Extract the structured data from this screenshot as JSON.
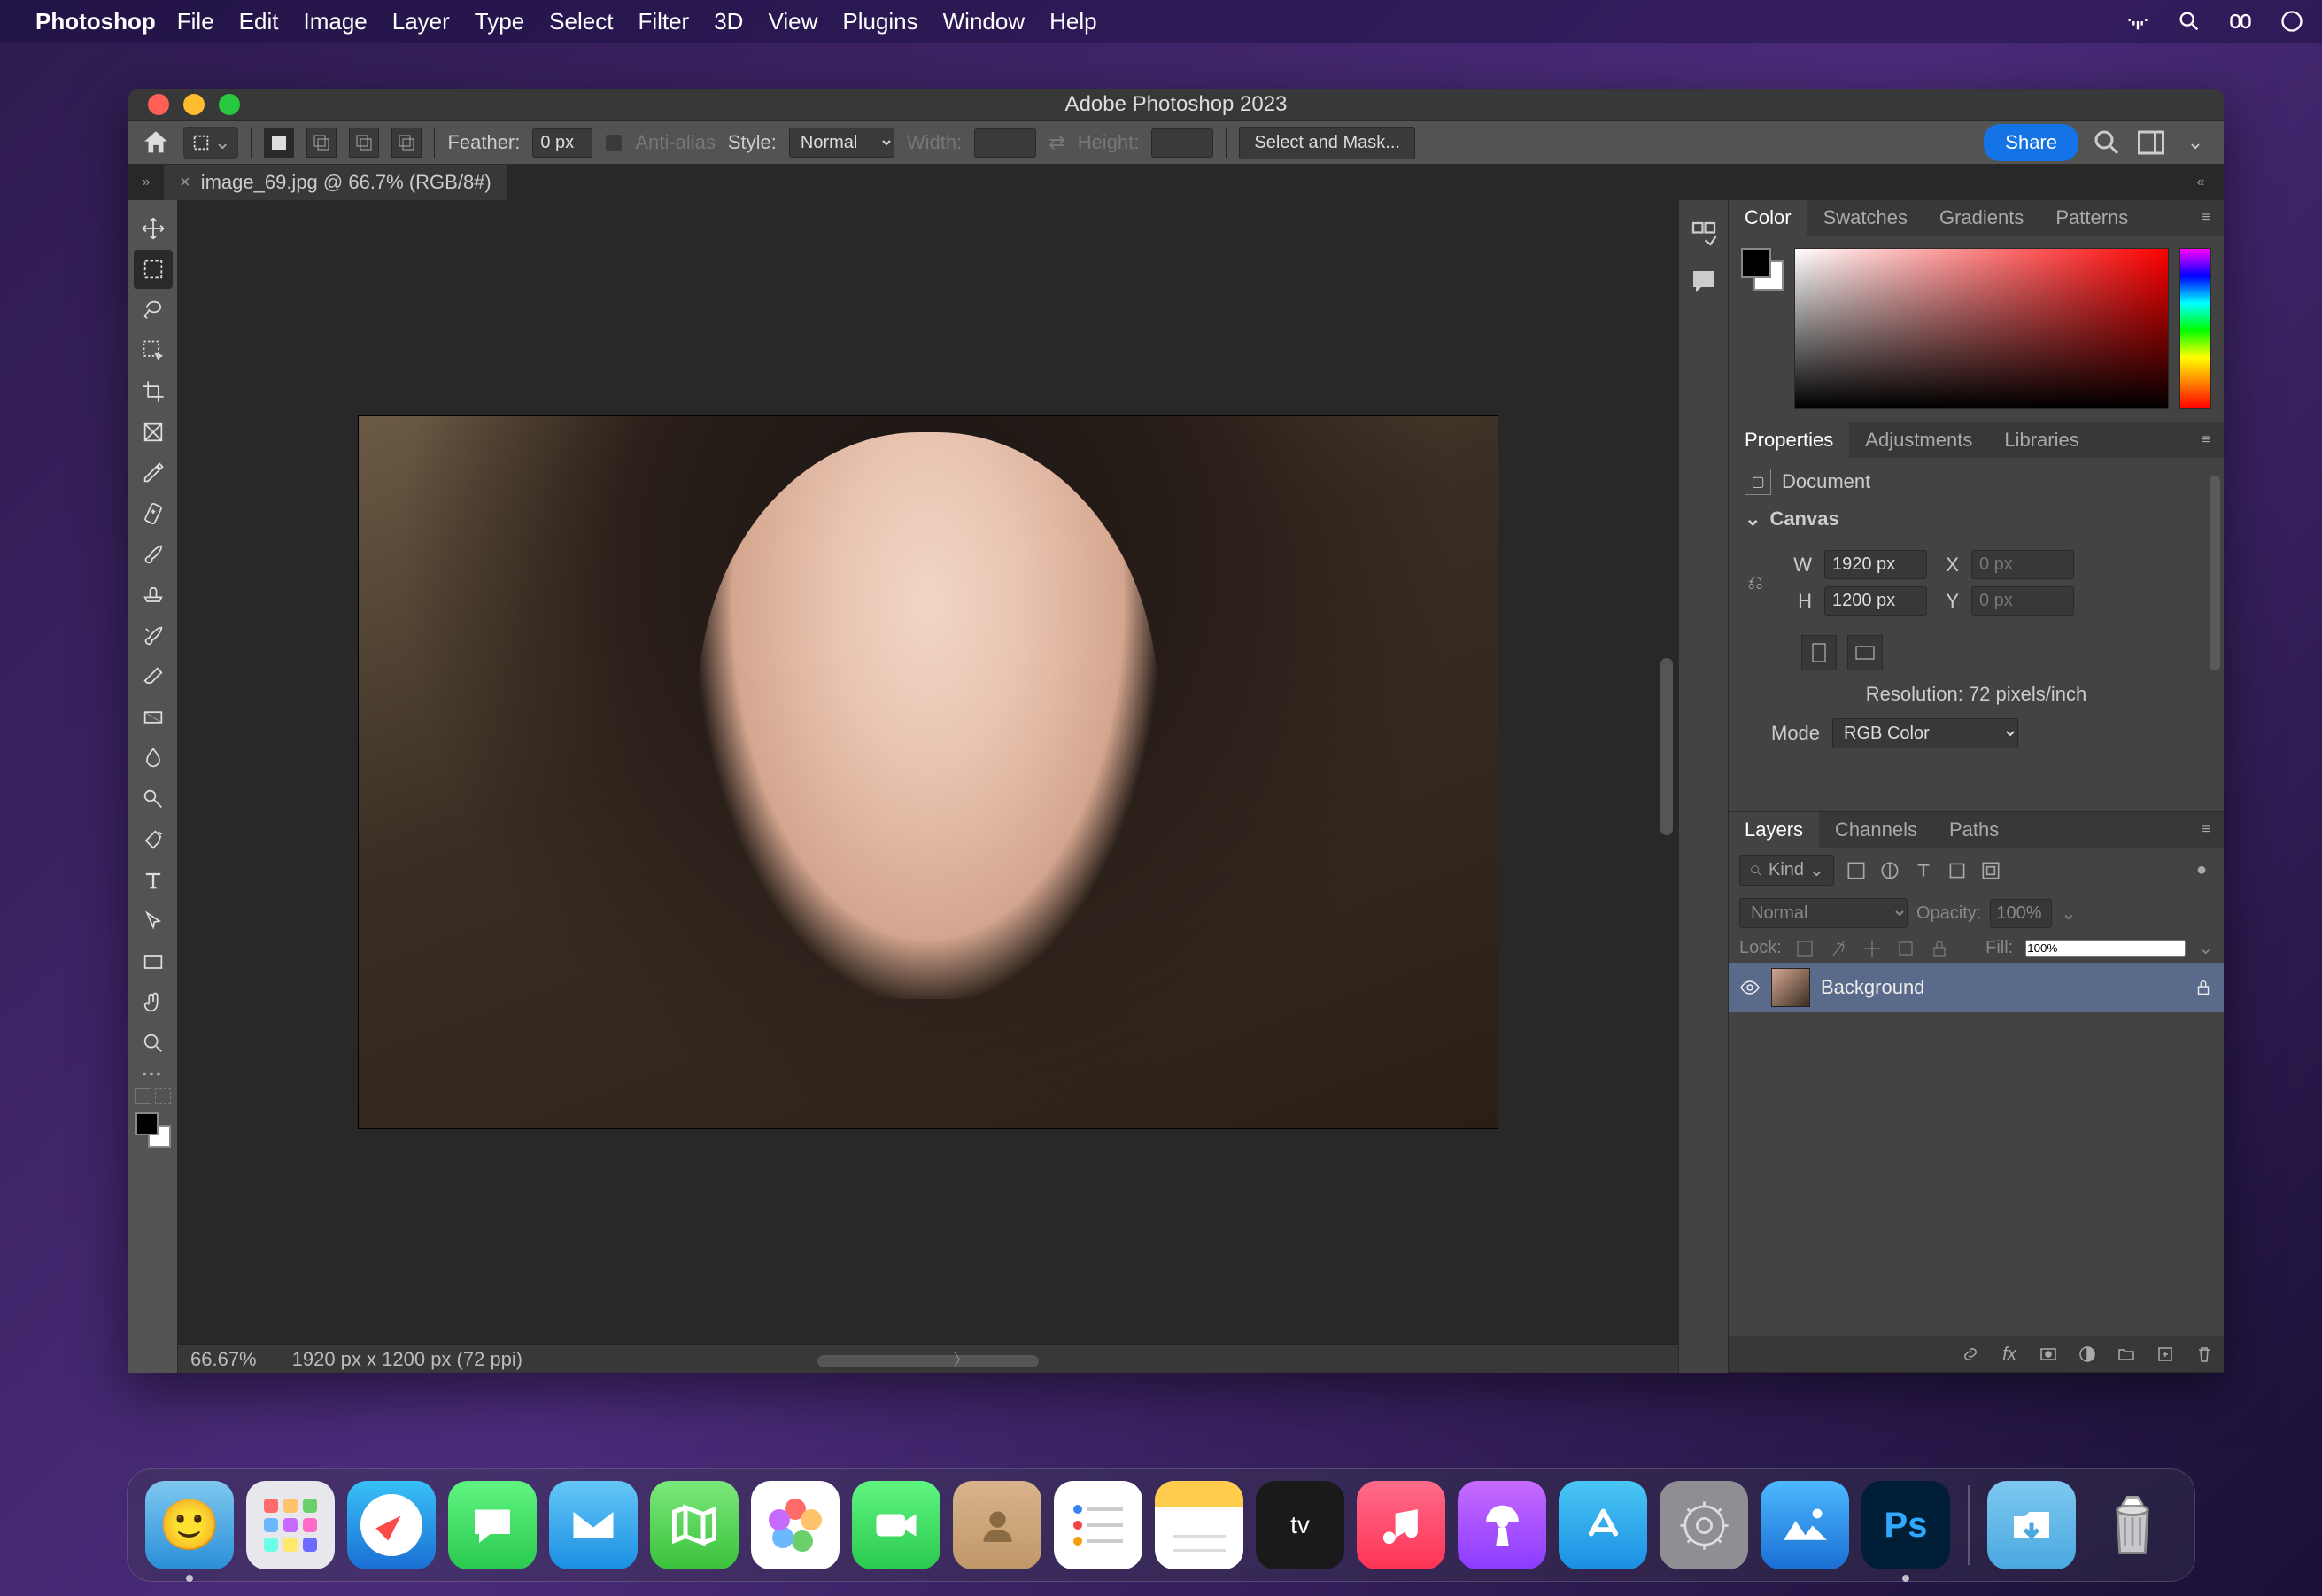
{
  "menubar": {
    "app_name": "Photoshop",
    "items": [
      "File",
      "Edit",
      "Image",
      "Layer",
      "Type",
      "Select",
      "Filter",
      "3D",
      "View",
      "Plugins",
      "Window",
      "Help"
    ]
  },
  "window": {
    "title": "Adobe Photoshop 2023"
  },
  "options_bar": {
    "feather_label": "Feather:",
    "feather_value": "0 px",
    "antialias_label": "Anti-alias",
    "style_label": "Style:",
    "style_value": "Normal",
    "width_label": "Width:",
    "height_label": "Height:",
    "select_mask": "Select and Mask...",
    "share": "Share"
  },
  "document_tab": {
    "name": "image_69.jpg @ 66.7% (RGB/8#)"
  },
  "statusbar": {
    "zoom": "66.67%",
    "dims": "1920 px x 1200 px (72 ppi)"
  },
  "panels": {
    "color_tabs": [
      "Color",
      "Swatches",
      "Gradients",
      "Patterns"
    ],
    "props_tabs": [
      "Properties",
      "Adjustments",
      "Libraries"
    ],
    "layers_tabs": [
      "Layers",
      "Channels",
      "Paths"
    ]
  },
  "properties": {
    "document_label": "Document",
    "canvas_label": "Canvas",
    "w_label": "W",
    "w_value": "1920 px",
    "h_label": "H",
    "h_value": "1200 px",
    "x_label": "X",
    "x_value": "0 px",
    "y_label": "Y",
    "y_value": "0 px",
    "resolution": "Resolution: 72 pixels/inch",
    "mode_label": "Mode",
    "mode_value": "RGB Color"
  },
  "layers": {
    "kind_label": "Kind",
    "blend_mode": "Normal",
    "opacity_label": "Opacity:",
    "opacity_value": "100%",
    "lock_label": "Lock:",
    "fill_label": "Fill:",
    "fill_value": "100%",
    "items": [
      {
        "name": "Background"
      }
    ]
  },
  "dock": {
    "apps": [
      "finder",
      "launchpad",
      "safari",
      "messages",
      "mail",
      "maps",
      "photos",
      "facetime",
      "contacts",
      "reminders",
      "notes",
      "tv",
      "music",
      "podcasts",
      "appstore",
      "settings",
      "landscape",
      "photoshop"
    ]
  }
}
